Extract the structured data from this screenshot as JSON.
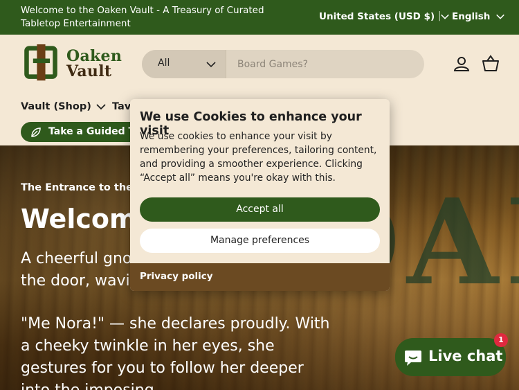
{
  "announcement": {
    "text": "Welcome to the Oaken Vault - A Treasury of Curated Tabletop Entertainment",
    "country": "United States (USD $)",
    "separator": "|",
    "language": "English"
  },
  "header": {
    "logo": {
      "line1": "Oaken",
      "line2": "Vault"
    },
    "search": {
      "category": "All",
      "placeholder": "Board Games?"
    },
    "icons": [
      "account-icon",
      "cart-icon"
    ]
  },
  "nav": {
    "items": [
      {
        "label": "Vault (Shop)"
      },
      {
        "label": "Tav"
      }
    ],
    "guided_tour": "Take a Guided Tour"
  },
  "hero": {
    "kicker": "The Entrance to the Oaken Vault",
    "title": "Welcome",
    "paragraph1": "A cheerful gnome pops out from behind the door, waving excitedly.",
    "paragraph2": "\"Me Nora!\" — she declares proudly. With a cheeky twinkle in her eyes, she gestures for you to follow her deeper into the imposing"
  },
  "cookie_banner": {
    "title": "We use Cookies to enhance your visit",
    "text": "We use cookies to enhance your visit by remembering your preferences, tailoring content, and providing a smoother experience. Clicking “Accept all” means you're okay with this.",
    "accept_label": "Accept all",
    "manage_label": "Manage preferences",
    "privacy_label": "Privacy policy"
  },
  "live_chat": {
    "label": "Live chat",
    "badge": "1"
  },
  "colors": {
    "brand_green": "#2f5a1c",
    "cream": "#f4e8d5",
    "brown": "#6b4a22",
    "badge_red": "#e0293f"
  }
}
